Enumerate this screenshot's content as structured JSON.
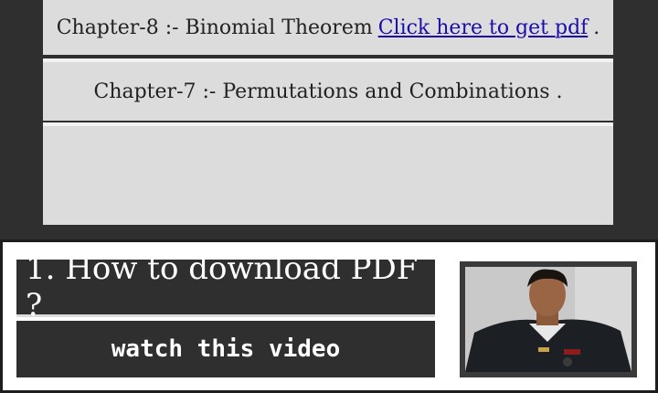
{
  "chapters": [
    {
      "label": "Chapter-8 :- Binomial Theorem",
      "link_text": "Click here to get pdf",
      "suffix": "."
    },
    {
      "label": "Chapter-7 :- Permutations and Combinations ."
    }
  ],
  "promo": {
    "title": "1. How to download PDF ?",
    "video_button": "watch this video",
    "photo_icon": "person-photo"
  },
  "colors": {
    "dark_bg": "#2f2f2f",
    "row_bg": "#dcdcdc",
    "link": "#1a0dab"
  }
}
